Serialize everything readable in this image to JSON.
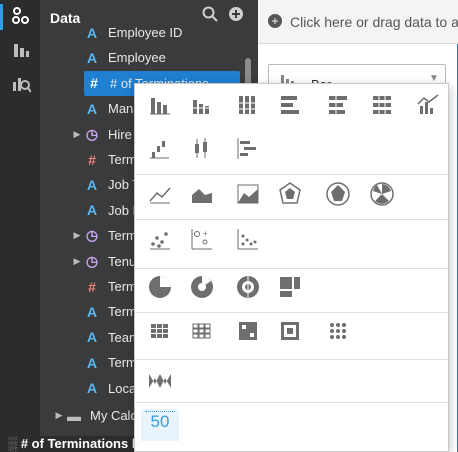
{
  "panel": {
    "title": "Data"
  },
  "fields": [
    {
      "label": "Employee ID",
      "type": "text"
    },
    {
      "label": "Employee",
      "type": "text"
    },
    {
      "label": "# of Terminations",
      "type": "number",
      "selected": true
    },
    {
      "label": "Manager",
      "type": "text"
    },
    {
      "label": "Hire Date",
      "type": "date",
      "expandable": true
    },
    {
      "label": "Termination Type",
      "type": "number"
    },
    {
      "label": "Job Title",
      "type": "text"
    },
    {
      "label": "Job Level",
      "type": "text"
    },
    {
      "label": "Termination Date",
      "type": "date",
      "expandable": true
    },
    {
      "label": "Tenure",
      "type": "date",
      "expandable": true
    },
    {
      "label": "Termination Reason",
      "type": "number"
    },
    {
      "label": "Termination Category",
      "type": "text"
    },
    {
      "label": "Team",
      "type": "text"
    },
    {
      "label": "Termination Status",
      "type": "text"
    },
    {
      "label": "Location",
      "type": "text"
    }
  ],
  "folder": {
    "label": "My Calculations"
  },
  "footer": {
    "label": "# of Terminations by Month"
  },
  "dropzone": {
    "text": "Click here or drag data to a"
  },
  "chart_select": {
    "label": "Bar"
  },
  "chart_types": {
    "groups": [
      [
        "bar-chart-icon",
        "stacked-bar-icon",
        "percent-stacked-bar-icon",
        "horizontal-bar-icon",
        "stacked-horizontal-bar-icon",
        "percent-stacked-horizontal-bar-icon",
        "bar-line-combo-icon"
      ],
      [
        "waterfall-icon",
        "boxplot-icon",
        "gantt-icon"
      ],
      [
        "line-chart-icon",
        "area-chart-icon",
        "line-area-icon",
        "radar-chart-icon",
        "filled-radar-icon",
        "polar-area-icon"
      ],
      [
        "scatter-icon",
        "bubble-scatter-icon",
        "dot-plot-icon"
      ],
      [
        "pie-chart-icon",
        "donut-chart-icon",
        "sunburst-icon",
        "treemap-icon"
      ],
      [
        "heatmap-icon",
        "grid-heatmap-icon",
        "pattern-grid-icon",
        "matrix-icon",
        "dot-matrix-icon"
      ],
      [
        "sankey-icon"
      ],
      [
        "kpi-number-icon"
      ]
    ],
    "kpi_label": "50"
  },
  "colors": {
    "accent": "#2f9fe3",
    "selection": "#1f7fd1",
    "panel": "#3a3b3d",
    "rail": "#2b2c2e"
  }
}
